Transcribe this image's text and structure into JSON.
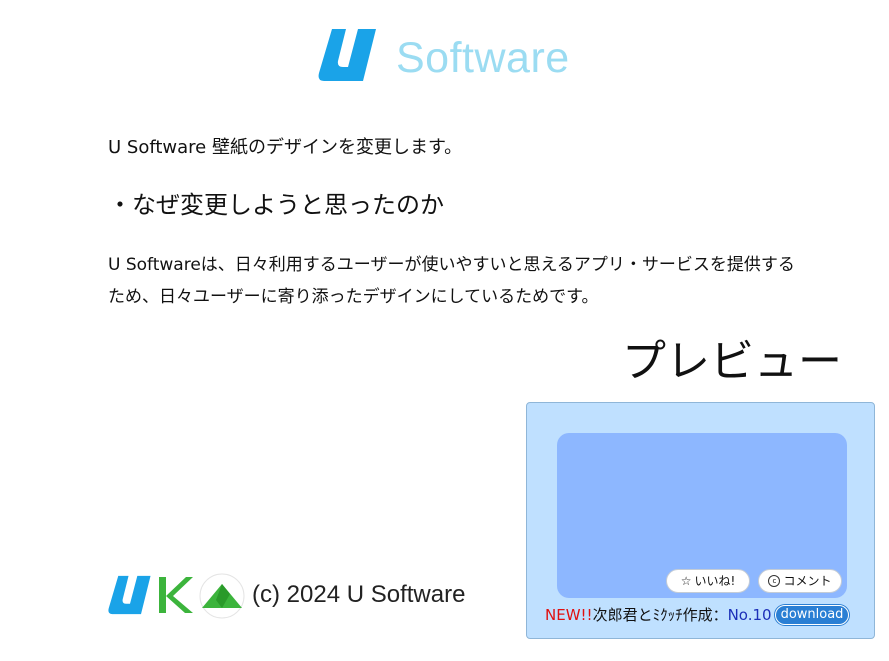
{
  "header": {
    "brand_name": "Software",
    "logo_icon": "u-logo-icon"
  },
  "intro": "U Software 壁紙のデザインを変更します。",
  "section_heading": "・なぜ変更しようと思ったのか",
  "body": {
    "line1": "U Softwareは、日々利用するユーザーが使いやすいと思えるアプリ・サービスを提供する",
    "line2": "ため、日々ユーザーに寄り添ったデザインにしているためです。"
  },
  "preview": {
    "heading": "プレビュー",
    "like_icon": "star-icon",
    "like_symbol": "☆",
    "like_label": "いいね!",
    "comment_icon": "comment-icon",
    "comment_symbol": "c",
    "comment_label": "コメント",
    "new_tag": "NEW!!",
    "caption": "次郎君とﾐｸｯﾁ作成：",
    "number": "No.10",
    "download_label": "download"
  },
  "footer": {
    "copyright": "(c) 2024 U Software",
    "logos": [
      "u-logo-icon",
      "k-logo-icon",
      "mountain-logo-icon"
    ]
  },
  "colors": {
    "brand_blue": "#1aa3e8",
    "brand_light": "#9bdcf2",
    "card_bg": "#bfe0ff",
    "image_bg": "#8db7ff",
    "new_red": "#e01010",
    "number_blue": "#1c2fb8",
    "download_blue": "#2a7fd4",
    "k_green": "#3cb43c"
  }
}
